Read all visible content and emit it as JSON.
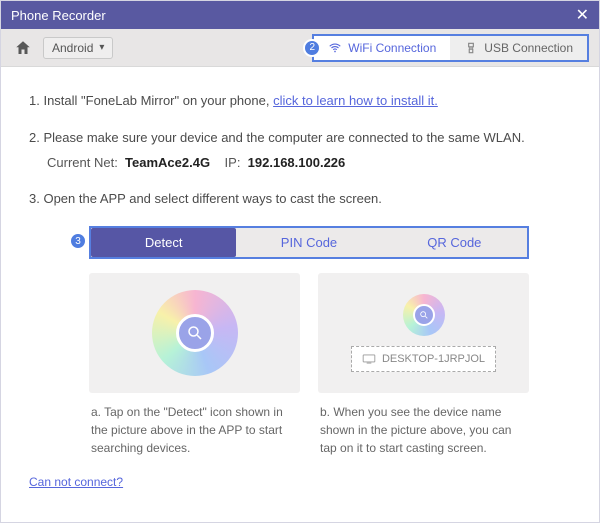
{
  "window": {
    "title": "Phone Recorder"
  },
  "toolbar": {
    "platform_selected": "Android",
    "connections": {
      "wifi": "WiFi Connection",
      "usb": "USB Connection"
    },
    "badge2": "2"
  },
  "instructions": {
    "item1_prefix": "1. Install \"FoneLab Mirror\" on your phone, ",
    "item1_link": "click to learn how to install it.",
    "item2": "2. Please make sure your device and the computer are connected to the same WLAN.",
    "net_label": "Current Net:",
    "net_value": "TeamAce2.4G",
    "ip_label": "IP:",
    "ip_value": "192.168.100.226",
    "item3": "3. Open the APP and select different ways to cast the screen."
  },
  "cast": {
    "badge3": "3",
    "tabs": {
      "detect": "Detect",
      "pin": "PIN Code",
      "qr": "QR Code"
    },
    "device_name": "DESKTOP-1JRPJOL",
    "caption_a": "a. Tap on the \"Detect\" icon shown in the picture above in the APP to start searching devices.",
    "caption_b": "b. When you see the device name shown in the picture above, you can tap on it to start casting screen."
  },
  "footer": {
    "cannot_connect": "Can not connect?"
  }
}
